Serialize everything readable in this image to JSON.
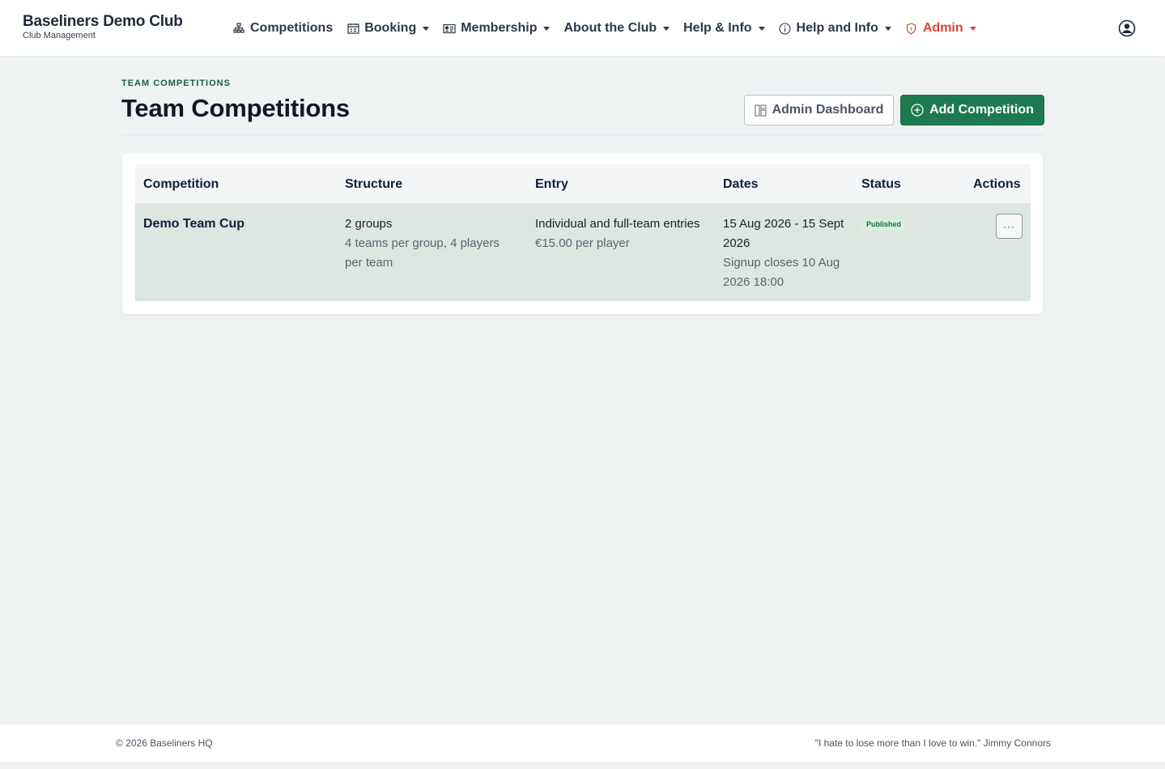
{
  "brand": {
    "name": "Baseliners Demo Club",
    "subtitle": "Club Management"
  },
  "nav": {
    "items": [
      {
        "label": "Competitions",
        "icon": "bracket-icon",
        "dropdown": false
      },
      {
        "label": "Booking",
        "icon": "calendar-icon",
        "dropdown": true
      },
      {
        "label": "Membership",
        "icon": "id-card-icon",
        "dropdown": true
      },
      {
        "label": "About the Club",
        "icon": "",
        "dropdown": true
      },
      {
        "label": "Help & Info",
        "icon": "",
        "dropdown": true
      },
      {
        "label": "Help and Info",
        "icon": "info-icon",
        "dropdown": true
      },
      {
        "label": "Admin",
        "icon": "shield-icon",
        "dropdown": true,
        "color": "#d64535"
      }
    ]
  },
  "header": {
    "eyebrow": "TEAM COMPETITIONS",
    "title": "Team Competitions",
    "admin_dashboard_label": "Admin Dashboard",
    "add_competition_label": "Add Competition"
  },
  "table": {
    "columns": [
      "Competition",
      "Structure",
      "Entry",
      "Dates",
      "Status",
      "Actions"
    ],
    "rows": [
      {
        "competition": "Demo Team Cup",
        "structure_main": "2 groups",
        "structure_sub": "4 teams per group, 4 players per team",
        "entry_main": "Individual and full-team entries",
        "entry_sub": "€15.00 per player",
        "dates_main": "15 Aug 2026 - 15 Sept 2026",
        "dates_sub": "Signup closes 10 Aug 2026 18:00",
        "status": "Published",
        "actions_label": "···"
      }
    ]
  },
  "footer": {
    "copyright": "© 2026 Baseliners HQ",
    "quote": "\"I hate to lose more than I love to win.\" Jimmy Connors"
  },
  "colors": {
    "primary": "#1e7a4e",
    "admin": "#d64535",
    "row_highlight": "#dde6e0",
    "background": "#eef2f3"
  }
}
